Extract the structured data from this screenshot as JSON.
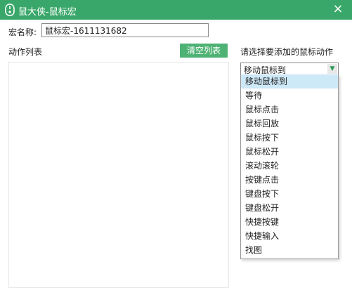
{
  "window": {
    "title": "鼠大侠-鼠标宏",
    "close_glyph": "×",
    "accent_color": "#3aa76a"
  },
  "form": {
    "name_label": "宏名称:",
    "name_value": "鼠标宏-1611131682"
  },
  "action_list": {
    "label": "动作列表",
    "clear_label": "清空列表",
    "items": []
  },
  "action_select": {
    "label": "请选择要添加的鼠标动作",
    "selected": "移动鼠标到",
    "options": [
      "移动鼠标到",
      "等待",
      "鼠标点击",
      "鼠标回放",
      "鼠标按下",
      "鼠标松开",
      "滚动滚轮",
      "按键点击",
      "键盘按下",
      "键盘松开",
      "快捷按键",
      "快捷输入",
      "找图"
    ]
  }
}
